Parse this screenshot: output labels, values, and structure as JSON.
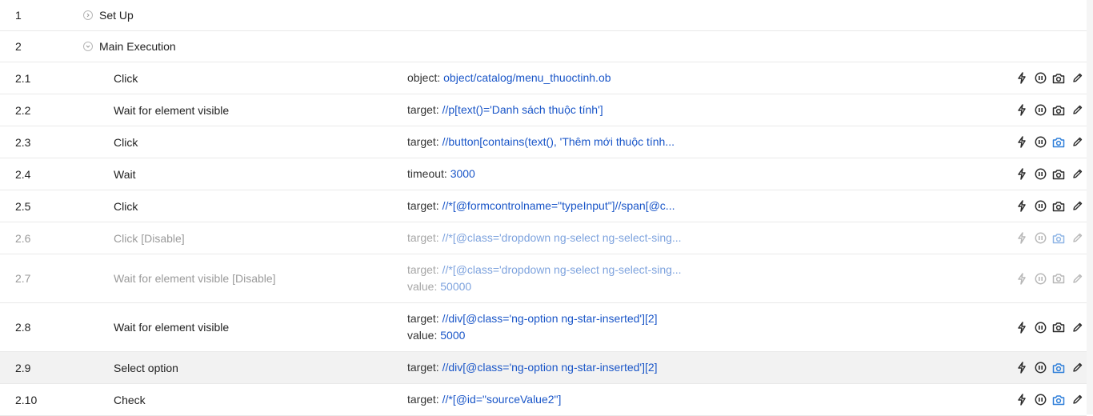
{
  "groups": [
    {
      "num": "1",
      "label": "Set Up",
      "expanded": false
    },
    {
      "num": "2",
      "label": "Main Execution",
      "expanded": true
    }
  ],
  "steps": [
    {
      "num": "2.1",
      "action": "Click",
      "params": [
        {
          "label": "object:",
          "value": "object/catalog/menu_thuoctinh.ob"
        }
      ]
    },
    {
      "num": "2.2",
      "action": "Wait for element visible",
      "params": [
        {
          "label": "target:",
          "value": "//p[text()='Danh sách thuộc tính']"
        }
      ]
    },
    {
      "num": "2.3",
      "action": "Click",
      "params": [
        {
          "label": "target:",
          "value": "//button[contains(text(), 'Thêm mới thuộc tính..."
        }
      ]
    },
    {
      "num": "2.4",
      "action": "Wait",
      "params": [
        {
          "label": "timeout:",
          "value": "3000"
        }
      ]
    },
    {
      "num": "2.5",
      "action": "Click",
      "params": [
        {
          "label": "target:",
          "value": "//*[@formcontrolname=\"typeInput\"]//span[@c..."
        }
      ]
    },
    {
      "num": "2.6",
      "action": "Click [Disable]",
      "params": [
        {
          "label": "target:",
          "value": "//*[@class='dropdown ng-select ng-select-sing..."
        }
      ]
    },
    {
      "num": "2.7",
      "action": "Wait for element visible [Disable]",
      "params": [
        {
          "label": "target:",
          "value": "//*[@class='dropdown ng-select ng-select-sing..."
        },
        {
          "label": "value:",
          "value": "50000"
        }
      ]
    },
    {
      "num": "2.8",
      "action": "Wait for element visible",
      "params": [
        {
          "label": "target:",
          "value": "//div[@class='ng-option ng-star-inserted'][2]"
        },
        {
          "label": "value:",
          "value": "5000"
        }
      ]
    },
    {
      "num": "2.9",
      "action": "Select option",
      "params": [
        {
          "label": "target:",
          "value": "//div[@class='ng-option ng-star-inserted'][2]"
        }
      ]
    },
    {
      "num": "2.10",
      "action": "Check",
      "params": [
        {
          "label": "target:",
          "value": "//*[@id=\"sourceValue2\"]"
        }
      ]
    }
  ],
  "row_icons": [
    "lightning-icon",
    "pause-icon",
    "camera-icon",
    "pencil-icon"
  ],
  "colors": {
    "link": "#1a56c8",
    "camera_active": "#2f7fd9",
    "highlight_row": "#f2f2f2",
    "disabled_text": "#9a9a9a"
  }
}
